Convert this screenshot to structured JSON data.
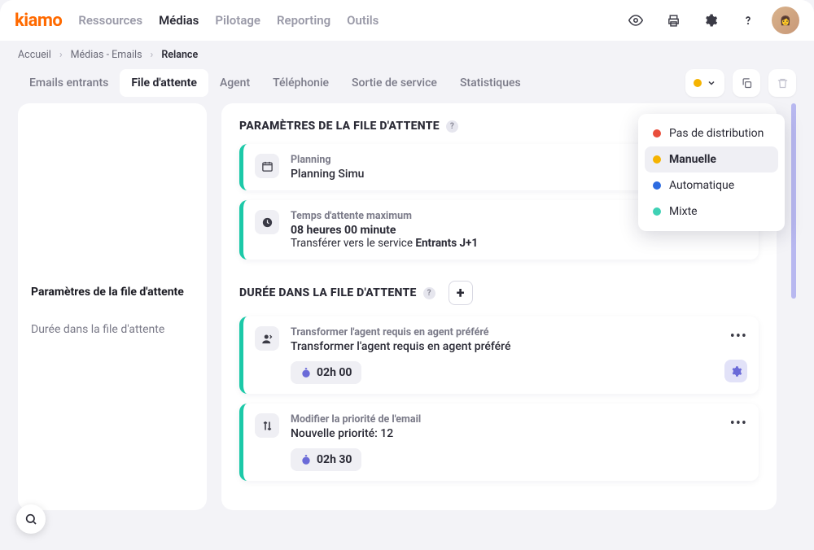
{
  "logo": "kiamo",
  "nav": {
    "items": [
      "Ressources",
      "Médias",
      "Pilotage",
      "Reporting",
      "Outils"
    ],
    "active": 1
  },
  "breadcrumb": [
    "Accueil",
    "Médias - Emails",
    "Relance"
  ],
  "tabs": {
    "items": [
      "Emails entrants",
      "File d'attente",
      "Agent",
      "Téléphonie",
      "Sortie de service",
      "Statistiques"
    ],
    "active": 1
  },
  "status_dropdown": {
    "options": [
      {
        "color": "#e94e3c",
        "label": "Pas de distribution"
      },
      {
        "color": "#f5b301",
        "label": "Manuelle"
      },
      {
        "color": "#2d6be0",
        "label": "Automatique"
      },
      {
        "color": "#3fd1b5",
        "label": "Mixte"
      }
    ],
    "selected": 1
  },
  "sidebar": {
    "items": [
      {
        "label": "Paramètres de la file d'attente",
        "active": true
      },
      {
        "label": "Durée dans la file d'attente",
        "active": false
      }
    ]
  },
  "section1": {
    "title": "PARAMÈTRES DE LA FILE D'ATTENTE",
    "cards": [
      {
        "icon": "calendar",
        "label": "Planning",
        "value": "Planning Simu"
      },
      {
        "icon": "clock",
        "label": "Temps d'attente maximum",
        "value": "08 heures 00 minute",
        "sub_pre": "Transférer vers le service ",
        "sub_strong": "Entrants J+1"
      }
    ]
  },
  "section2": {
    "title": "DURÉE DANS LA FILE D'ATTENTE",
    "cards": [
      {
        "icon": "agent",
        "label": "Transformer l'agent requis en agent préféré",
        "value": "Transformer l'agent requis en agent préféré",
        "time": "02h 00",
        "gear": true
      },
      {
        "icon": "priority",
        "label": "Modifier la priorité de l'email",
        "value": "Nouvelle priorité: 12",
        "time": "02h 30"
      }
    ]
  }
}
